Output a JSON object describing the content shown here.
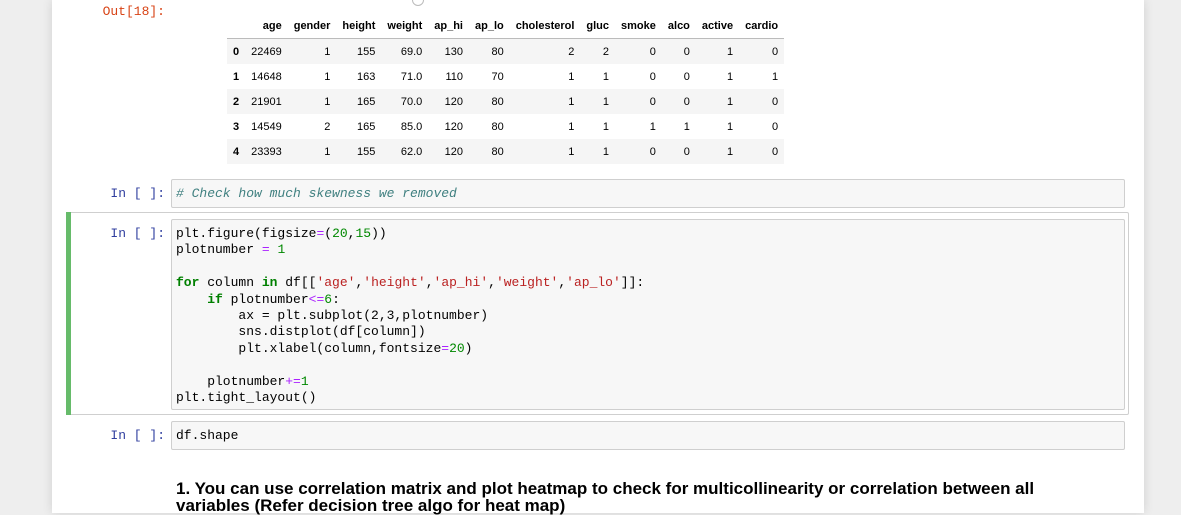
{
  "output_cell": {
    "prompt": "Out[18]:",
    "columns": [
      "",
      "age",
      "gender",
      "height",
      "weight",
      "ap_hi",
      "ap_lo",
      "cholesterol",
      "gluc",
      "smoke",
      "alco",
      "active",
      "cardio"
    ],
    "rows": [
      [
        "0",
        "22469",
        "1",
        "155",
        "69.0",
        "130",
        "80",
        "2",
        "2",
        "0",
        "0",
        "1",
        "0"
      ],
      [
        "1",
        "14648",
        "1",
        "163",
        "71.0",
        "110",
        "70",
        "1",
        "1",
        "0",
        "0",
        "1",
        "1"
      ],
      [
        "2",
        "21901",
        "1",
        "165",
        "70.0",
        "120",
        "80",
        "1",
        "1",
        "0",
        "0",
        "1",
        "0"
      ],
      [
        "3",
        "14549",
        "2",
        "165",
        "85.0",
        "120",
        "80",
        "1",
        "1",
        "1",
        "1",
        "1",
        "0"
      ],
      [
        "4",
        "23393",
        "1",
        "155",
        "62.0",
        "120",
        "80",
        "1",
        "1",
        "0",
        "0",
        "1",
        "0"
      ]
    ]
  },
  "cell_skewness": {
    "prompt": "In [ ]:",
    "code": "# Check how much skewness we removed"
  },
  "cell_plot": {
    "prompt": "In [ ]:",
    "lines": {
      "l1a": "plt.figure(figsize",
      "l1b": "=",
      "l1c": "(",
      "l1d": "20",
      "l1e": ",",
      "l1f": "15",
      "l1g": "))",
      "l2a": "plotnumber ",
      "l2b": "=",
      "l2c": " ",
      "l2d": "1",
      "l4a": "for",
      "l4b": " column ",
      "l4c": "in",
      "l4d": " df[[",
      "l4e": "'age'",
      "l4f": ",",
      "l4g": "'height'",
      "l4h": ",",
      "l4i": "'ap_hi'",
      "l4j": ",",
      "l4k": "'weight'",
      "l4l": ",",
      "l4m": "'ap_lo'",
      "l4n": "]]:",
      "l5a": "    ",
      "l5b": "if",
      "l5c": " plotnumber",
      "l5d": "<=",
      "l5e": "6",
      "l5f": ":",
      "l6": "        ax = plt.subplot(2,3,plotnumber)",
      "l7": "        sns.distplot(df[column])",
      "l8a": "        plt.xlabel(column,fontsize",
      "l8b": "=",
      "l8c": "20",
      "l8d": ")",
      "l10a": "    plotnumber",
      "l10b": "+=",
      "l10c": "1",
      "l11a": "plt.tight_layout",
      "l11b": "()"
    }
  },
  "cell_shape": {
    "prompt": "In [ ]:",
    "code": "df.shape"
  },
  "markdown": {
    "text": "1. You can use correlation matrix and plot heatmap to check for multicollinearity or correlation between all variables (Refer decision tree algo for heat map)"
  }
}
